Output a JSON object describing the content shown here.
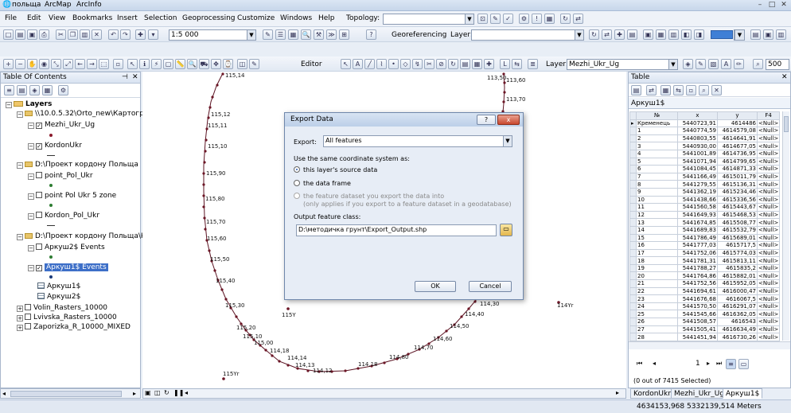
{
  "window": {
    "title": "польща",
    "app": "ArcMap",
    "license": "ArcInfo"
  },
  "menu": [
    "File",
    "Edit",
    "View",
    "Bookmarks",
    "Insert",
    "Selection",
    "Geoprocessing",
    "Customize",
    "Windows",
    "Help"
  ],
  "toolbars": {
    "topology_label": "Topology:",
    "scale": "1:5 000",
    "georeferencing": "Georeferencing",
    "layer_label": "Layer:",
    "editor": "Editor",
    "active_layer": "Mezhi_Ukr_Ug",
    "zoom_value": "500"
  },
  "toc": {
    "title": "Table Of Contents",
    "root": "Layers",
    "items": [
      {
        "type": "folder",
        "label": "\\\\10.0.5.32\\Orto_new\\Картограф"
      },
      {
        "type": "layer",
        "label": "Mezhi_Ukr_Ug",
        "checked": true
      },
      {
        "type": "layer",
        "label": "KordonUkr",
        "checked": true
      },
      {
        "type": "folder",
        "label": "D:\\Проект кордону Польща"
      },
      {
        "type": "layer",
        "label": "point_Pol_Ukr",
        "checked": false
      },
      {
        "type": "layer",
        "label": "point Pol Ukr 5 zone",
        "checked": false
      },
      {
        "type": "layer",
        "label": "Kordon_Pol_Ukr",
        "checked": false
      },
      {
        "type": "folder",
        "label": "D:\\Проект кордону Польща\\Ко"
      },
      {
        "type": "layer",
        "label": "Аркуш2$ Events",
        "checked": false
      },
      {
        "type": "layer",
        "label": "Аркуш1$ Events",
        "checked": true
      },
      {
        "type": "table",
        "label": "Аркуш1$"
      },
      {
        "type": "table",
        "label": "Аркуш2$"
      },
      {
        "type": "layer",
        "label": "Volin_Rasters_10000",
        "checked": false
      },
      {
        "type": "layer",
        "label": "Lvivska_Rasters_10000",
        "checked": false
      },
      {
        "type": "layer",
        "label": "Zaporizka_R_10000_MIXED",
        "checked": false
      }
    ]
  },
  "map_labels": [
    "115,14",
    "115,12",
    "115,11",
    "115,10",
    "115,90",
    "115,80",
    "115,70",
    "115,60",
    "115,50",
    "115,40",
    "115,30",
    "115,20",
    "115,10",
    "115,00",
    "114,18",
    "114,14",
    "114,13",
    "114,12",
    "114,18",
    "114,80",
    "114,70",
    "114,60",
    "114,50",
    "114,40",
    "114,30",
    "113,50",
    "113,60",
    "113,70",
    "115Y",
    "114Yr",
    "115Yr"
  ],
  "dialog": {
    "title": "Export Data",
    "help": "?",
    "close": "x",
    "export_label": "Export:",
    "export_value": "All features",
    "coord_label": "Use the same coordinate system as:",
    "opt1": "this layer's source data",
    "opt2": "the data frame",
    "opt3": "the feature dataset you export the data into",
    "opt3_note": "(only applies if you export to a feature dataset in a geodatabase)",
    "output_label": "Output feature class:",
    "output_path": "D:\\методичка грунт\\Export_Output.shp",
    "ok": "OK",
    "cancel": "Cancel"
  },
  "table_window": {
    "title": "Table",
    "sheet": "Аркуш1$",
    "columns": [
      "№",
      "x",
      "y",
      "F4"
    ],
    "rows": [
      [
        "Кременець",
        "5440723,91",
        "4614486",
        "<Null>"
      ],
      [
        "1",
        "5440774,59",
        "4614579,08",
        "<Null>"
      ],
      [
        "2",
        "5440803,55",
        "4614641,91",
        "<Null>"
      ],
      [
        "3",
        "5440930,00",
        "4614677,05",
        "<Null>"
      ],
      [
        "4",
        "5441001,89",
        "4614736,95",
        "<Null>"
      ],
      [
        "5",
        "5441071,94",
        "4614799,65",
        "<Null>"
      ],
      [
        "6",
        "5441084,45",
        "4614871,33",
        "<Null>"
      ],
      [
        "7",
        "5441166,49",
        "4615011,79",
        "<Null>"
      ],
      [
        "8",
        "5441279,55",
        "4615136,31",
        "<Null>"
      ],
      [
        "9",
        "5441362,19",
        "4615234,46",
        "<Null>"
      ],
      [
        "10",
        "5441438,66",
        "4615336,56",
        "<Null>"
      ],
      [
        "11",
        "5441560,58",
        "4615443,67",
        "<Null>"
      ],
      [
        "12",
        "5441649,93",
        "4615468,53",
        "<Null>"
      ],
      [
        "13",
        "5441674,85",
        "4615508,77",
        "<Null>"
      ],
      [
        "14",
        "5441689,83",
        "4615532,79",
        "<Null>"
      ],
      [
        "15",
        "5441786,49",
        "4615689,01",
        "<Null>"
      ],
      [
        "16",
        "5441777,03",
        "4615717,5",
        "<Null>"
      ],
      [
        "17",
        "5441752,06",
        "4615774,03",
        "<Null>"
      ],
      [
        "18",
        "5441781,31",
        "4615813,11",
        "<Null>"
      ],
      [
        "19",
        "5441788,27",
        "4615835,2",
        "<Null>"
      ],
      [
        "20",
        "5441764,86",
        "4615882,01",
        "<Null>"
      ],
      [
        "21",
        "5441752,56",
        "4615952,05",
        "<Null>"
      ],
      [
        "22",
        "5441694,61",
        "4616000,47",
        "<Null>"
      ],
      [
        "23",
        "5441676,68",
        "4616067,5",
        "<Null>"
      ],
      [
        "24",
        "5441570,50",
        "4616291,07",
        "<Null>"
      ],
      [
        "25",
        "5441545,66",
        "4616362,05",
        "<Null>"
      ],
      [
        "26",
        "5441508,57",
        "4616543",
        "<Null>"
      ],
      [
        "27",
        "5441505,41",
        "4616634,49",
        "<Null>"
      ],
      [
        "28",
        "5441451,94",
        "4616730,26",
        "<Null>"
      ]
    ],
    "nav_record": "1",
    "selection_status": "(0 out of 7415 Selected)",
    "tabs": [
      "KordonUkr",
      "Mezhi_Ukr_Ug",
      "Аркуш1$"
    ]
  },
  "status": {
    "coords": "4634153,968  5332139,514 Meters"
  }
}
